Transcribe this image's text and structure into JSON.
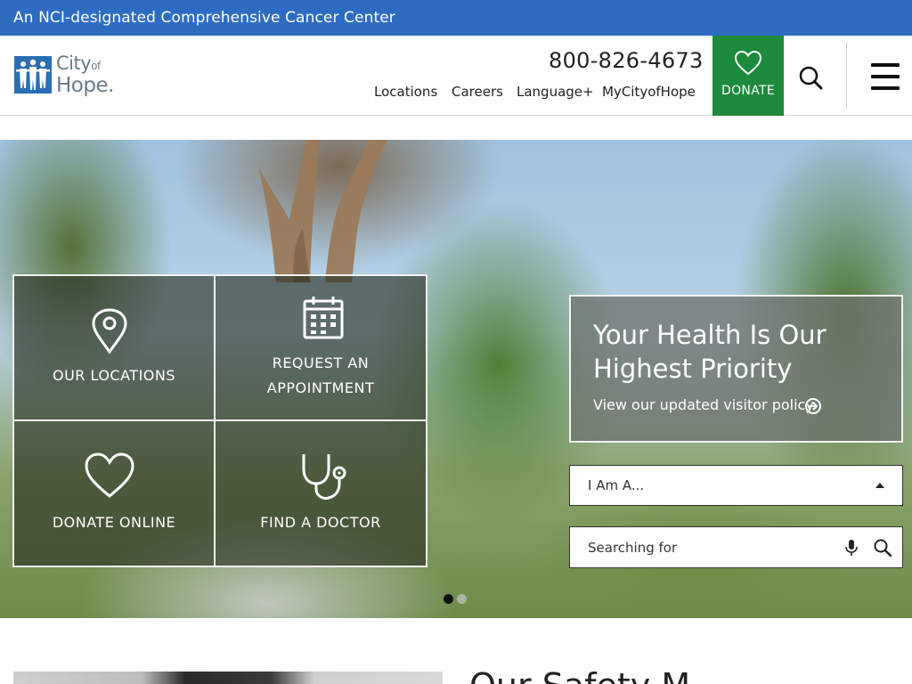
{
  "banner": {
    "text": "An NCI-designated Comprehensive Cancer Center"
  },
  "header": {
    "logo": {
      "line1": "City",
      "line1_small": "of",
      "line2": "Hope",
      "tm": "."
    },
    "phone": "800-826-4673",
    "nav": [
      "Locations",
      "Careers",
      "Language+",
      "MyCityofHope"
    ],
    "donate_label": "DONATE",
    "icons": {
      "donate": "heart-icon",
      "search": "search-icon",
      "menu": "hamburger-menu-icon"
    },
    "donate_color": "#1e8a3c"
  },
  "colors": {
    "banner": "#2e6cc2",
    "donate": "#1e8a3c"
  },
  "tiles": [
    {
      "label": "OUR LOCATIONS",
      "icon": "map-pin-icon"
    },
    {
      "label_line1": "REQUEST AN",
      "label_line2": "APPOINTMENT",
      "icon": "calendar-icon"
    },
    {
      "label": "DONATE ONLINE",
      "icon": "heart-icon"
    },
    {
      "label": "FIND A DOCTOR",
      "icon": "stethoscope-icon"
    }
  ],
  "promo": {
    "title": "Your Health Is Our Highest Priority",
    "link": "View our updated visitor policy"
  },
  "finder": {
    "select_value": "I Am A...",
    "search_placeholder": "Searching for"
  },
  "carousel": {
    "slide_count": 2,
    "active_index": 0
  },
  "next_section": {
    "title": "Our Safety M"
  }
}
